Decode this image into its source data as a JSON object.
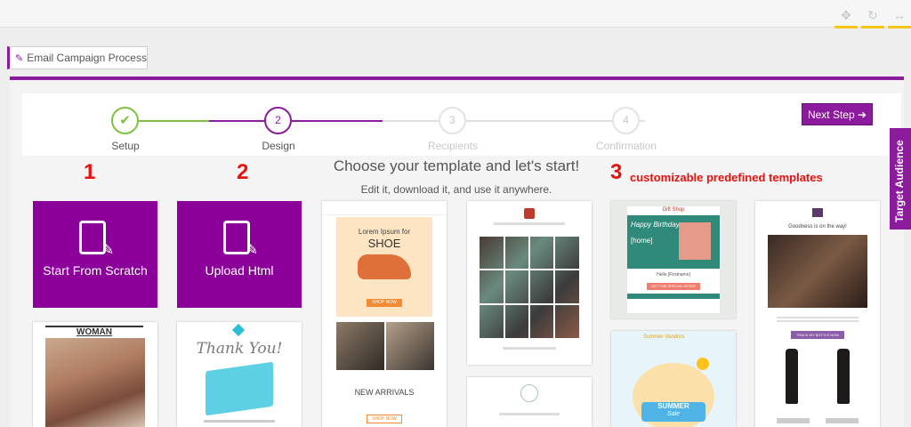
{
  "breadcrumb": {
    "label": "Email Campaign Process"
  },
  "stepper": {
    "steps": [
      {
        "number": "✔",
        "label": "Setup",
        "status": "done"
      },
      {
        "number": "2",
        "label": "Design",
        "status": "active"
      },
      {
        "number": "3",
        "label": "Recipients",
        "status": "pending"
      },
      {
        "number": "4",
        "label": "Confirmation",
        "status": "pending"
      }
    ],
    "next_label": "Next Step ➔"
  },
  "side_tab": {
    "label": "Target Audience"
  },
  "annotations": {
    "one": "1",
    "two": "2",
    "three": "3",
    "three_text": "customizable predefined templates"
  },
  "main": {
    "heading": "Choose your template and let's start!",
    "subheading": "Edit it, download it, and use it anywhere.",
    "options": [
      {
        "label": "Start From Scratch"
      },
      {
        "label": "Upload Html"
      }
    ]
  },
  "templates": {
    "woman": {
      "title": "WOMAN"
    },
    "thankyou": {
      "title": "Thank You!"
    },
    "shoe": {
      "headline": "Lorem Ipsum for",
      "product": "SHOE",
      "cta": "SHOP NOW",
      "section": "NEW ARRIVALS",
      "cta2": "SHOP NOW"
    },
    "birthday": {
      "brand": "Gift Shop",
      "title": "Happy Birthday",
      "tag": "[home]",
      "greeting": "Hello [Firstname]",
      "cta": "GET THE SPECIAL OFFER"
    },
    "summer": {
      "brand": "Summer Vendors",
      "title": "SUMMER",
      "sub": "Sale"
    },
    "wine": {
      "tagline": "Goodness is on the way!",
      "cta": "TRACK MY BOTTLE NOW"
    }
  },
  "colors": {
    "accent": "#8b1a9c",
    "done": "#7dc242",
    "annotation": "#e8110e"
  }
}
